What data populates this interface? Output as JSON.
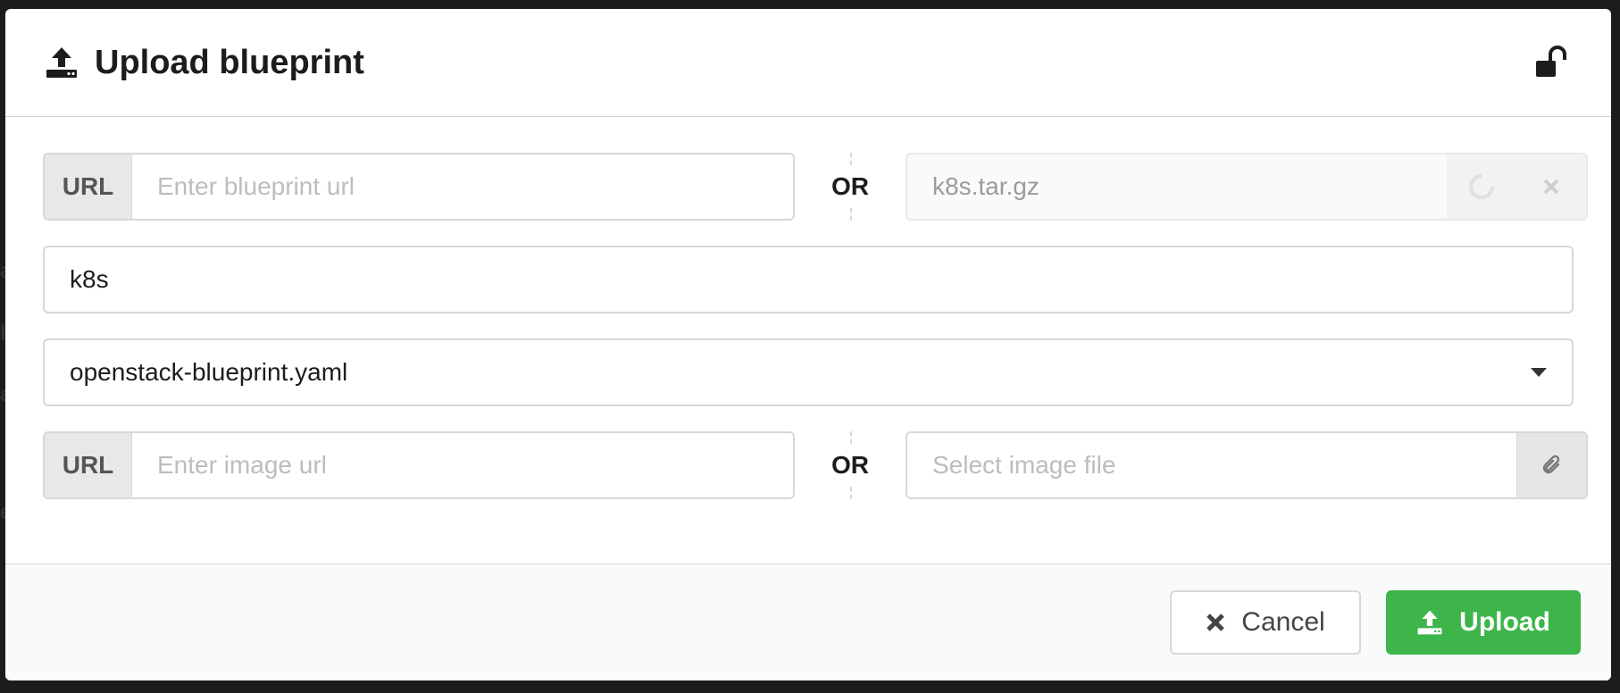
{
  "modal": {
    "title": "Upload blueprint",
    "header_icon": "upload-icon",
    "lock_icon": "unlock-icon"
  },
  "blueprint_source": {
    "url_label": "URL",
    "url_placeholder": "Enter blueprint url",
    "or_text": "OR",
    "file_value": "k8s.tar.gz",
    "reset_icon": "refresh-icon",
    "clear_icon": "close-icon"
  },
  "blueprint_name": {
    "value": "k8s"
  },
  "blueprint_file": {
    "selected": "openstack-blueprint.yaml",
    "caret_icon": "caret-down-icon"
  },
  "image_source": {
    "url_label": "URL",
    "url_placeholder": "Enter image url",
    "or_text": "OR",
    "file_placeholder": "Select image file",
    "attach_icon": "paperclip-icon"
  },
  "footer": {
    "cancel_label": "Cancel",
    "upload_label": "Upload"
  },
  "colors": {
    "primary": "#3db54a",
    "backdrop": "#1b1c1d"
  }
}
